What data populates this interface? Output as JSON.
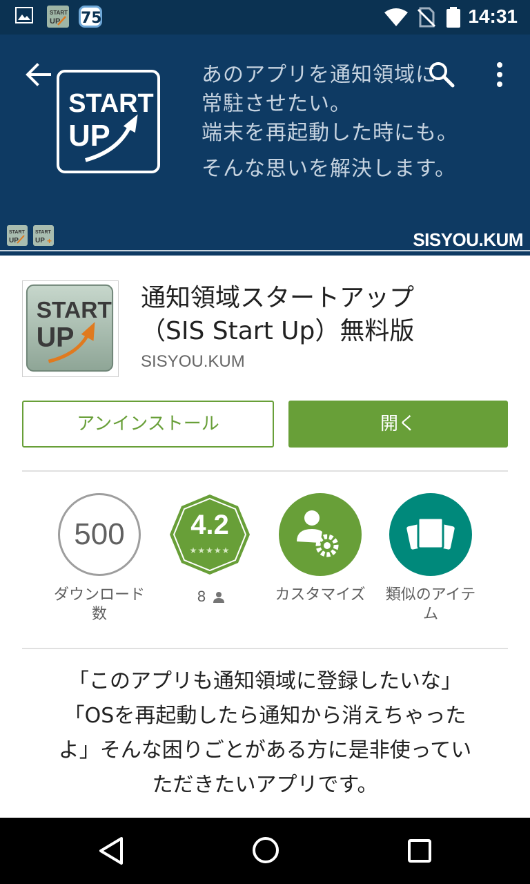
{
  "status_bar": {
    "badge_count": "75",
    "time": "14:31",
    "icons": [
      "gallery-icon",
      "startup-app-icon",
      "wifi-icon",
      "no-signal-icon",
      "battery-icon"
    ]
  },
  "banner": {
    "text_lines": [
      "あのアプリを通知領域に",
      "常駐させたい。",
      "端末を再起動した時にも。",
      "そんな思いを解決します。"
    ],
    "logo_text_top": "START",
    "logo_text_bottom": "UP",
    "brand": "SISYOU.KUM",
    "background_color": "#0e3a63"
  },
  "app": {
    "title_line1": "通知領域スタートアップ",
    "title_line2": "（SIS Start Up）無料版",
    "developer": "SISYOU.KUM"
  },
  "actions": {
    "uninstall_label": "アンインストール",
    "open_label": "開く",
    "accent_color": "#689f38"
  },
  "stats": {
    "downloads_value": "500",
    "downloads_label_line1": "ダウンロード",
    "downloads_label_line2": "数",
    "rating_value": "4.2",
    "rating_stars": "★★★★★",
    "reviews_count": "8",
    "customize_label": "カスタマイズ",
    "similar_label_line1": "類似のアイテ",
    "similar_label_line2": "ム"
  },
  "description": {
    "lines": [
      "「このアプリも通知領域に登録したいな」",
      "「OSを再起動したら通知から消えちゃった",
      "よ」そんな困りごとがある方に是非使ってい",
      "ただきたいアプリです。"
    ]
  }
}
